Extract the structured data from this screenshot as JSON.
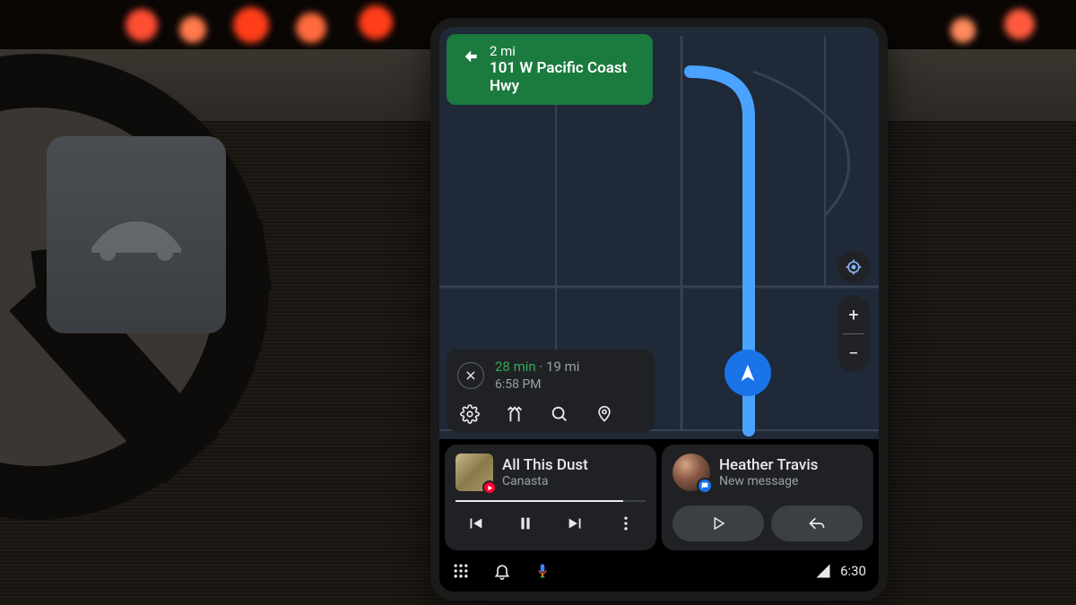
{
  "navigation": {
    "turn": {
      "distance": "2 mi",
      "road": "101 W Pacific Coast Hwy"
    },
    "eta": {
      "duration": "28 min",
      "distance": "19 mi",
      "arrival": "6:58 PM"
    }
  },
  "media": {
    "title": "All This Dust",
    "artist": "Canasta"
  },
  "message": {
    "sender": "Heather Travis",
    "status": "New message"
  },
  "system": {
    "time": "6:30"
  }
}
